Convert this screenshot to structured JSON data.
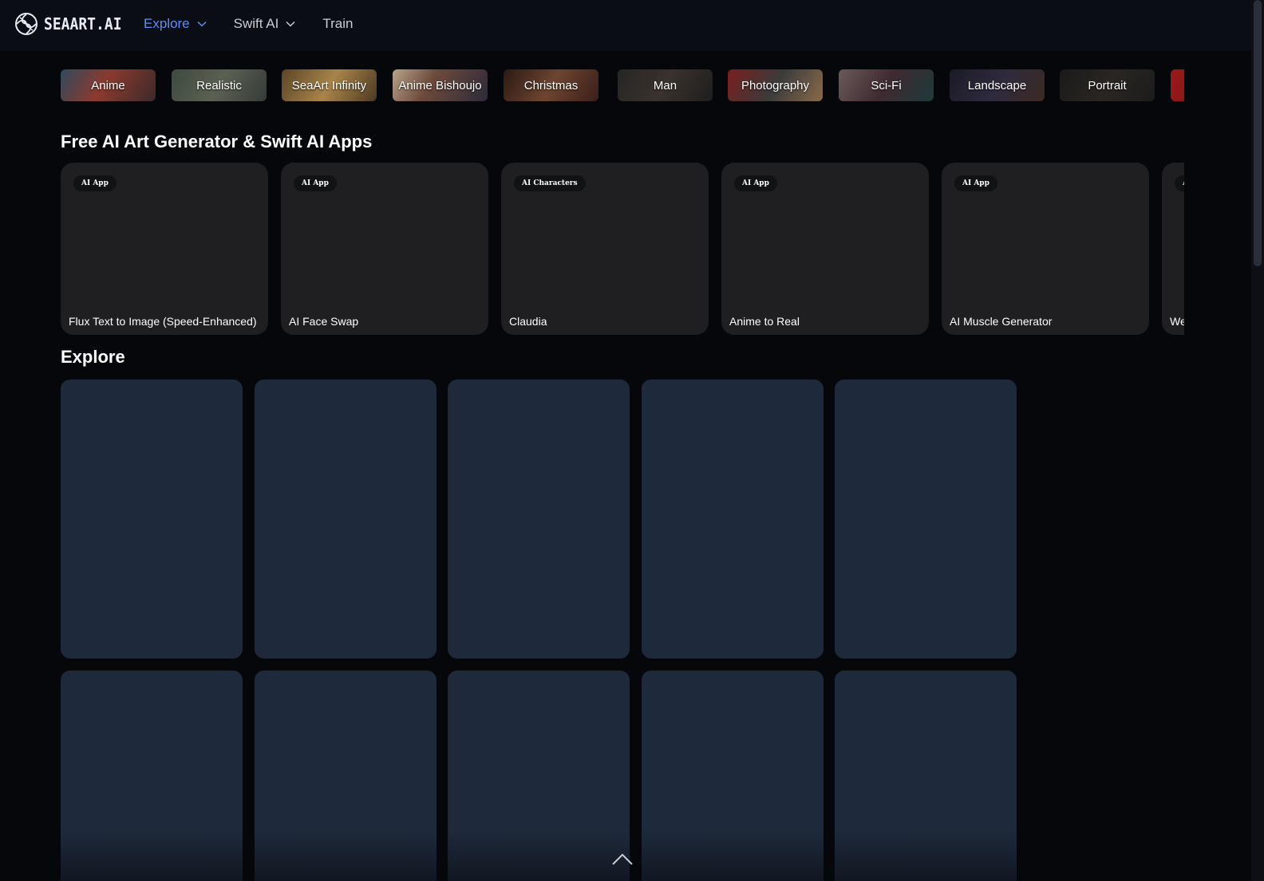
{
  "header": {
    "logo_text": "SEAART.AI",
    "nav": [
      {
        "label": "Explore",
        "active": true,
        "dropdown": true
      },
      {
        "label": "Swift AI",
        "active": false,
        "dropdown": true
      },
      {
        "label": "Train",
        "active": false,
        "dropdown": false
      }
    ]
  },
  "categories": [
    {
      "label": "Anime"
    },
    {
      "label": "Realistic"
    },
    {
      "label": "SeaArt Infinity"
    },
    {
      "label": "Anime Bishoujo"
    },
    {
      "label": "Christmas"
    },
    {
      "label": "Man"
    },
    {
      "label": "Photography"
    },
    {
      "label": "Sci-Fi"
    },
    {
      "label": "Landscape"
    },
    {
      "label": "Portrait"
    },
    {
      "label": ""
    }
  ],
  "apps_section": {
    "title": "Free AI Art Generator & Swift AI Apps",
    "cards": [
      {
        "badge": "AI App",
        "title": "Flux Text to Image (Speed-Enhanced)"
      },
      {
        "badge": "AI App",
        "title": "AI Face Swap"
      },
      {
        "badge": "AI Characters",
        "title": "Claudia"
      },
      {
        "badge": "AI App",
        "title": "Anime to Real"
      },
      {
        "badge": "AI App",
        "title": "AI Muscle Generator"
      },
      {
        "badge": "AI App",
        "title": "We"
      }
    ]
  },
  "explore_section": {
    "title": "Explore",
    "tile_color": "#1e2a3c"
  },
  "colors": {
    "background": "#06070b",
    "header": "#0b0d14",
    "accent": "#5b8ef5",
    "card": "#1f1f21"
  },
  "icons": {
    "logo": "seaart-swirl-icon",
    "dropdown": "chevron-down-icon",
    "scroll_top": "chevron-up-icon"
  }
}
